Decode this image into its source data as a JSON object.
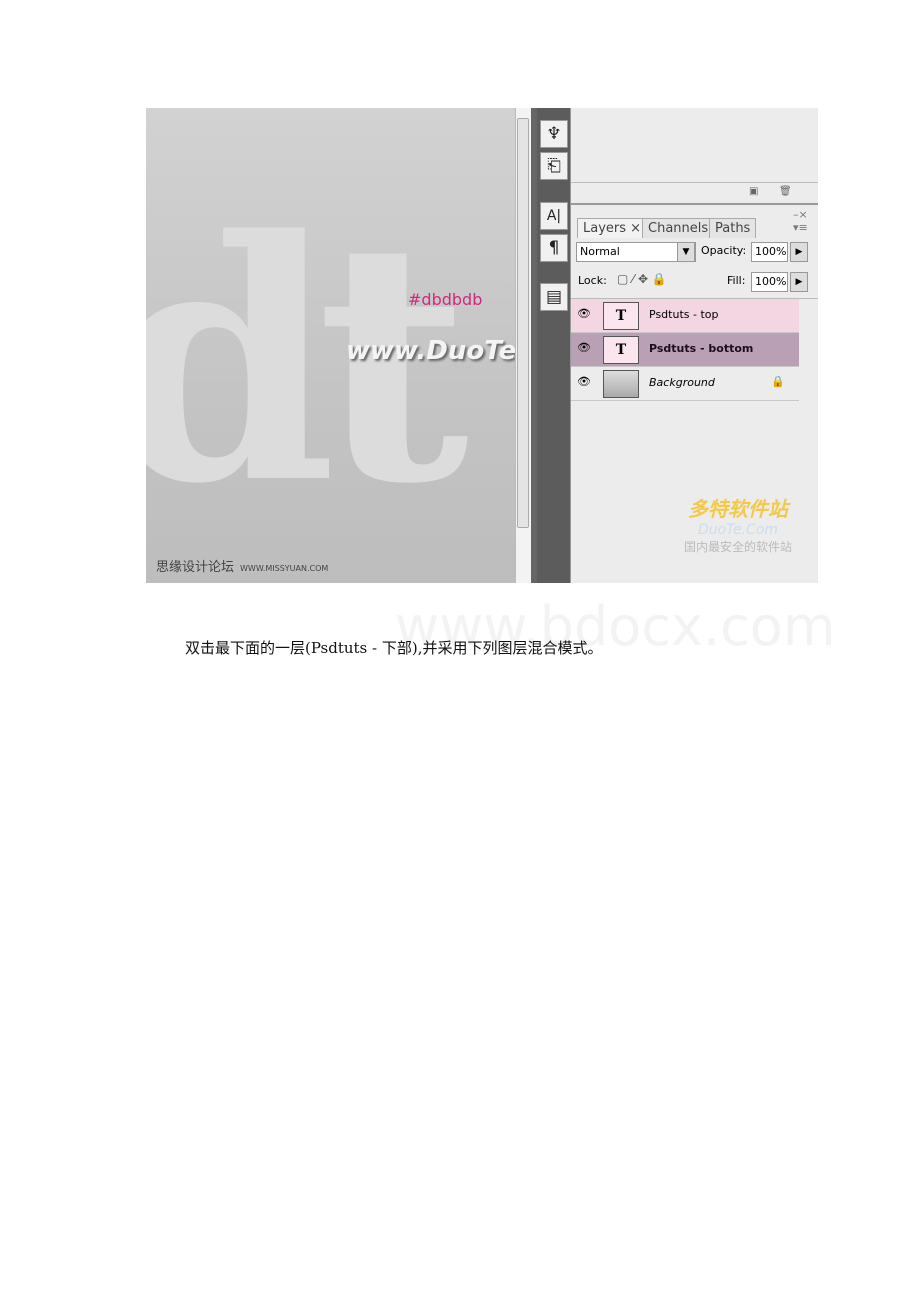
{
  "screenshot": {
    "canvas": {
      "big_letters": "dt",
      "hex_label": "#dbdbdb",
      "watermark": "www.DuoTe.com",
      "credit_cn": "思缘设计论坛",
      "credit_url": "WWW.MISSYUAN.COM"
    },
    "tools": {
      "icons": [
        "brush-presets-icon",
        "clone-source-icon",
        "character-icon",
        "paragraph-icon",
        "layer-comps-icon"
      ],
      "glyphs": [
        "♆",
        "⎗",
        "A|",
        "¶",
        "▤"
      ]
    },
    "panel": {
      "tabs": [
        "Layers ×",
        "Channels",
        "Paths"
      ],
      "blend_mode": "Normal",
      "opacity_label": "Opacity:",
      "opacity": "100%",
      "lock_label": "Lock:",
      "fill_label": "Fill:",
      "fill": "100%",
      "layers": [
        {
          "name": "Psdtuts - top",
          "thumb": "T",
          "color": "#f4d6e2"
        },
        {
          "name": "Psdtuts - bottom",
          "thumb": "T",
          "color": "#b9a0b4",
          "selected": true
        },
        {
          "name": "Background",
          "thumb": "",
          "locked": true
        }
      ],
      "logo_brand": "多特软件站",
      "logo_sub": "DuoTe.Com",
      "logo_tagline": "国内最安全的软件站"
    }
  },
  "caption": "双击最下面的一层(Psdtuts - 下部),并采用下列图层混合模式。",
  "watermark": "www.bdocx.com"
}
